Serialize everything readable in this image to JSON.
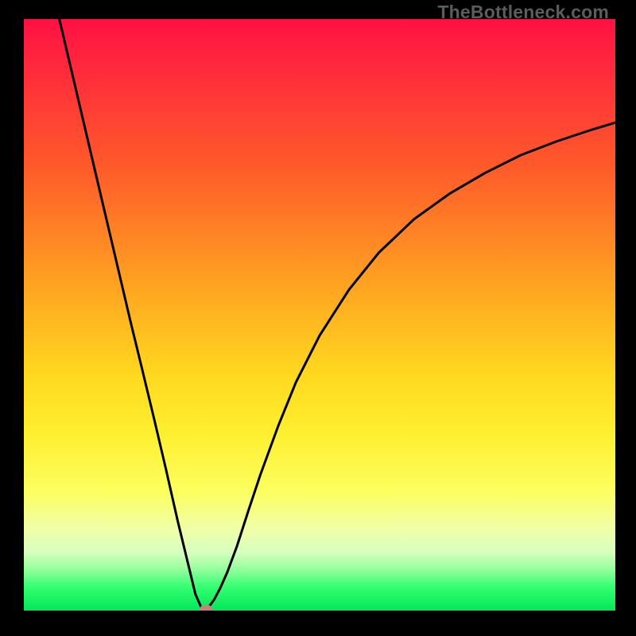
{
  "watermark": "TheBottleneck.com",
  "colors": {
    "frame_bg": "#000000",
    "gradient_top": "#ff1044",
    "gradient_bottom": "#04e658",
    "curve": "#000000",
    "marker_fill": "#c98079",
    "marker_stroke": "#7a4a44"
  },
  "chart_data": {
    "type": "line",
    "title": "",
    "xlabel": "",
    "ylabel": "",
    "xlim": [
      0,
      100
    ],
    "ylim": [
      0,
      100
    ],
    "grid": false,
    "legend": false,
    "series": [
      {
        "name": "curve",
        "x": [
          6,
          8,
          10,
          12,
          14,
          16,
          18,
          20,
          22,
          24,
          26,
          27.5,
          29,
          30,
          30.8,
          31.4,
          32.2,
          33.2,
          34.4,
          36,
          38,
          40,
          43,
          46,
          50,
          55,
          60,
          66,
          72,
          78,
          84,
          90,
          96,
          100
        ],
        "y": [
          100,
          91.5,
          83,
          74.5,
          66,
          57.5,
          49,
          40.8,
          32.5,
          24,
          15.2,
          9,
          2.8,
          0.5,
          0.2,
          0.8,
          1.9,
          3.8,
          6.5,
          10.8,
          17,
          23,
          31.2,
          38.6,
          46.5,
          54.3,
          60.5,
          66.2,
          70.5,
          74,
          77,
          79.3,
          81.3,
          82.5
        ]
      }
    ],
    "marker": {
      "x": 30.8,
      "y": 0.2
    }
  }
}
